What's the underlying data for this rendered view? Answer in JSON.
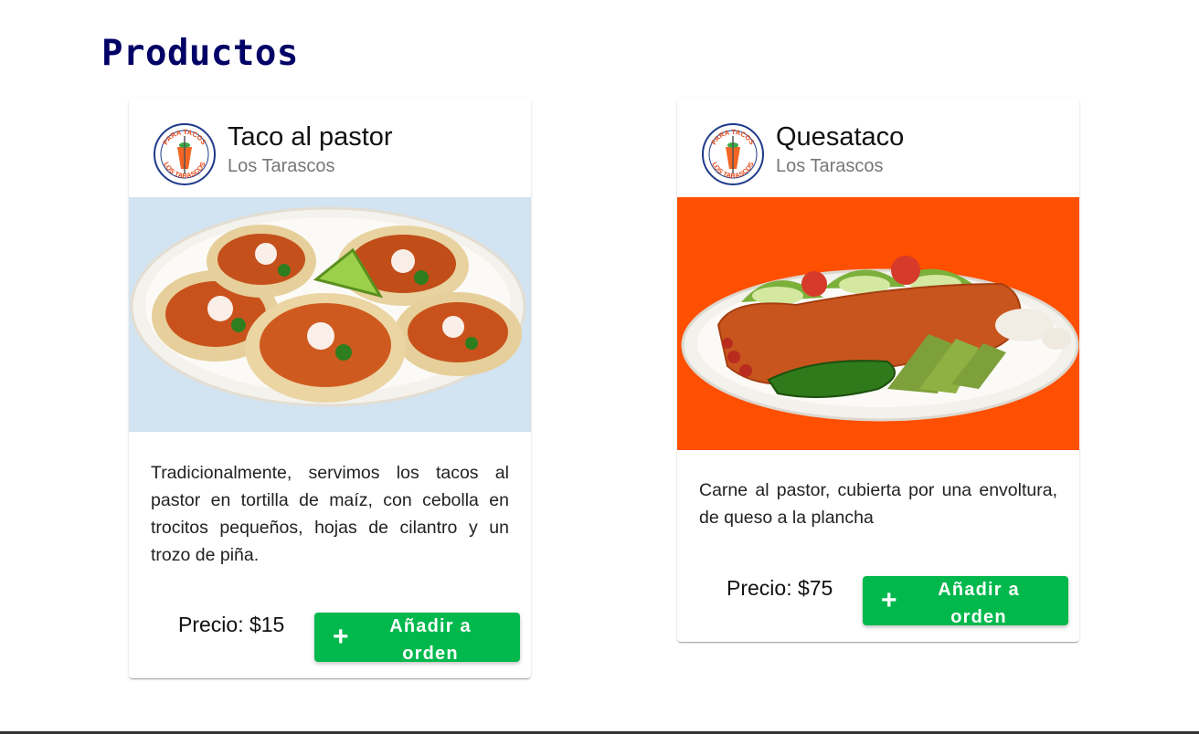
{
  "page": {
    "title": "Productos"
  },
  "colors": {
    "title": "#000066",
    "button": "#00b84c",
    "media_pastor": "#d2e3f1",
    "media_quesataco": "#ff4f00"
  },
  "products": [
    {
      "name": "Taco al pastor",
      "vendor": "Los Tarascos",
      "logo_icon": "los-tarascos-logo",
      "image": "taco-al-pastor-plate-photo",
      "description": "Tradicionalmente, servimos los tacos al pastor en tortilla de maíz, con cebolla en trocitos pequeños, hojas de cilantro y un trozo de piña.",
      "price": "Precio: $15",
      "add_label": "Añadir a orden",
      "add_icon": "+"
    },
    {
      "name": "Quesataco",
      "vendor": "Los Tarascos",
      "logo_icon": "los-tarascos-logo",
      "image": "quesataco-plate-photo",
      "description": "Carne al pastor, cubierta por una envoltura, de queso a la plancha",
      "price": "Precio: $75",
      "add_label": "Añadir a orden",
      "add_icon": "+"
    }
  ],
  "logo": {
    "top_text": "PARA TACOS",
    "bottom_text": "LOS TARASCOS"
  }
}
